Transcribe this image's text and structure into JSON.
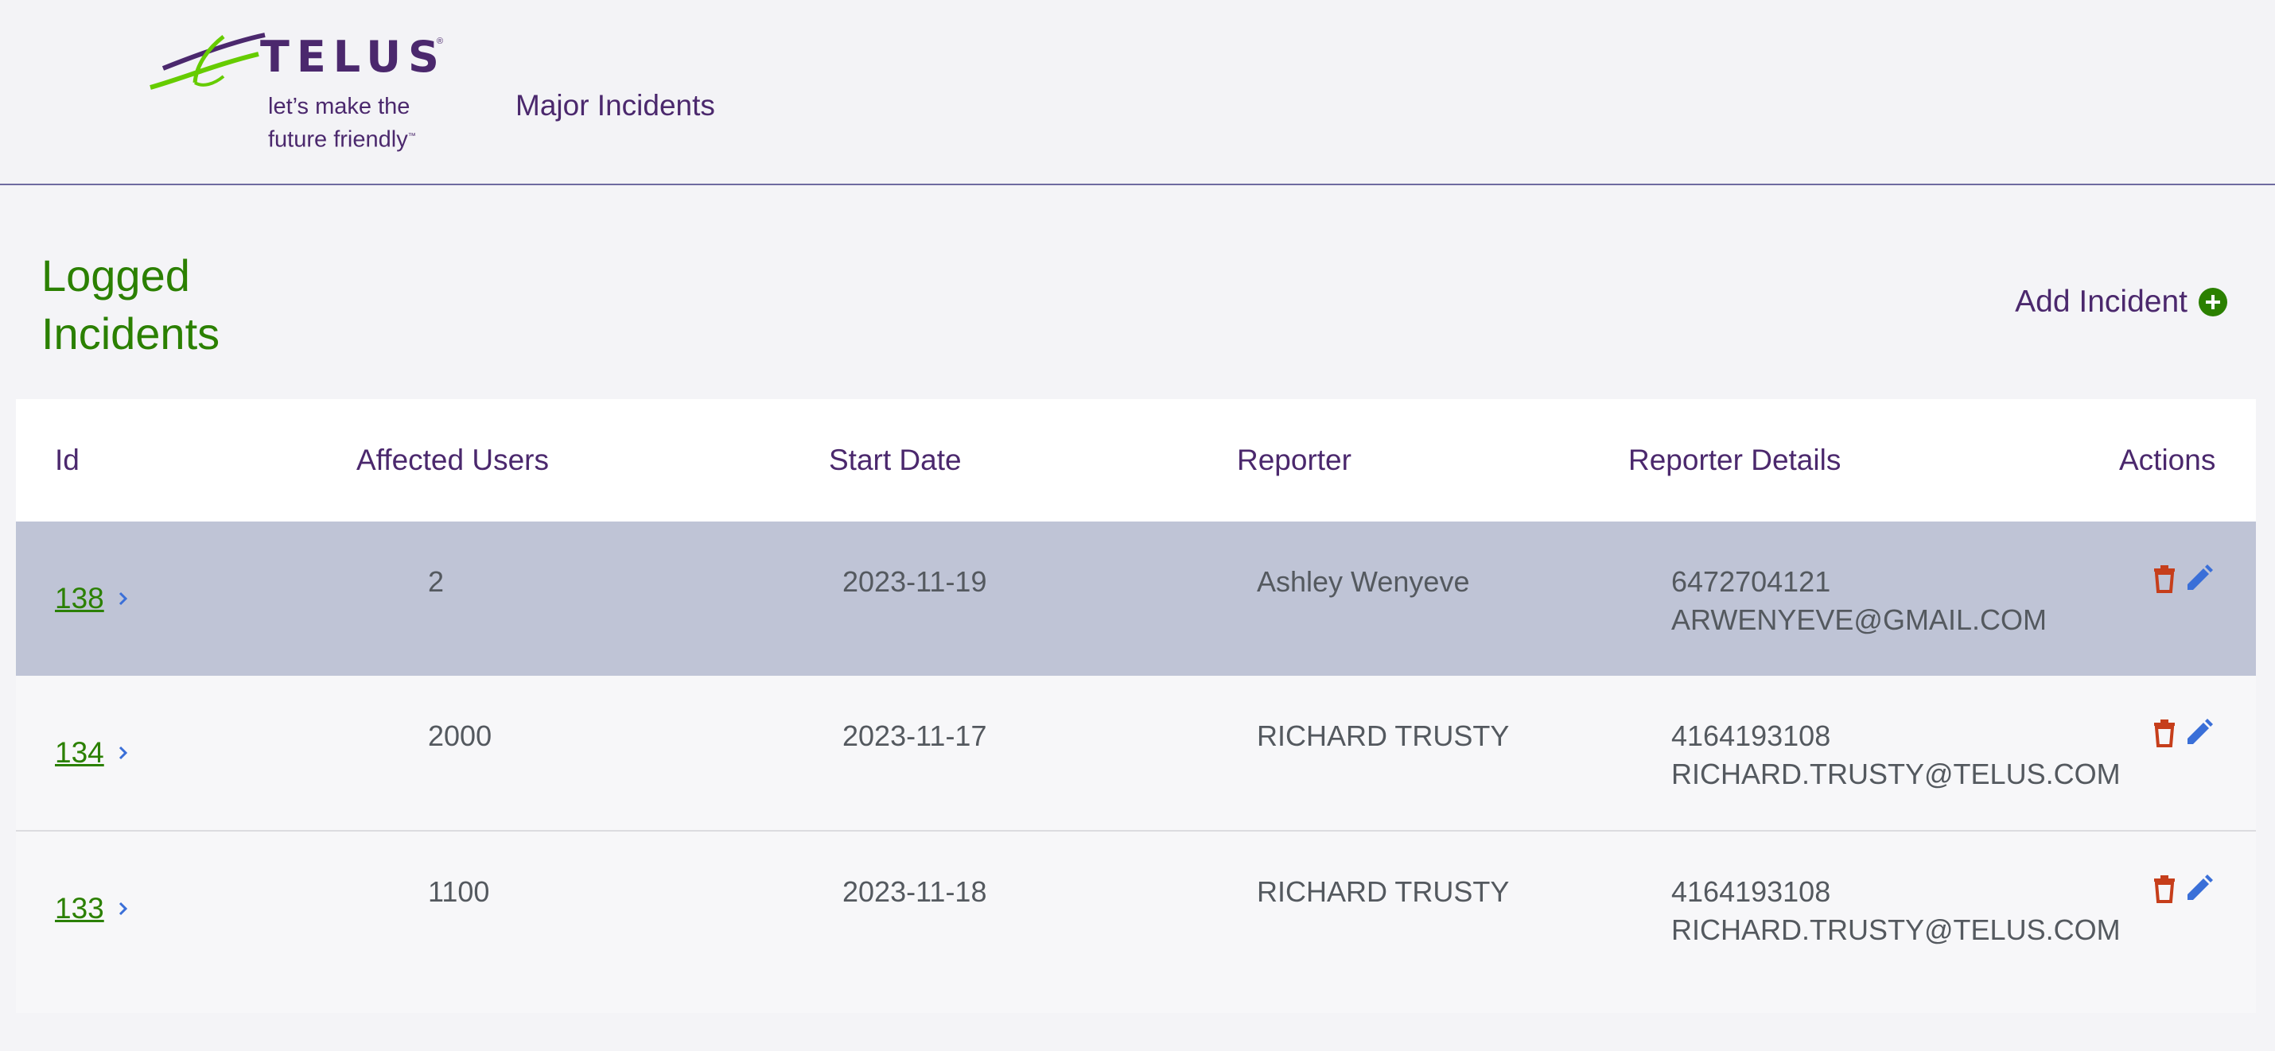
{
  "header": {
    "logo": {
      "wordmark": "TELUS",
      "tagline_line1": "let’s make the",
      "tagline_line2": "future friendly",
      "mark": "telus-swoosh-logo"
    },
    "app_title": "Major Incidents"
  },
  "page": {
    "title_line1": "Logged",
    "title_line2": "Incidents",
    "add_label": "Add Incident",
    "add_icon": "plus-circle-icon"
  },
  "table": {
    "columns": [
      "Id",
      "Affected Users",
      "Start Date",
      "Reporter",
      "Reporter Details",
      "Actions"
    ],
    "rows": [
      {
        "id": "138",
        "affected_users": "2",
        "start_date": "2023-11-19",
        "reporter": "Ashley Wenyeve",
        "phone": "6472704121",
        "email": "ARWENYEVE@GMAIL.COM",
        "selected": true
      },
      {
        "id": "134",
        "affected_users": "2000",
        "start_date": "2023-11-17",
        "reporter": "RICHARD TRUSTY",
        "phone": "4164193108",
        "email": "RICHARD.TRUSTY@TELUS.COM",
        "selected": false
      },
      {
        "id": "133",
        "affected_users": "1100",
        "start_date": "2023-11-18",
        "reporter": "RICHARD TRUSTY",
        "phone": "4164193108",
        "email": "RICHARD.TRUSTY@TELUS.COM",
        "selected": false
      }
    ],
    "icons": {
      "row_link": "chevron-right-icon",
      "delete": "trash-icon",
      "edit": "pencil-icon"
    }
  },
  "colors": {
    "brand_purple": "#4b286d",
    "brand_green": "#2b8000",
    "selected_row": "#bfc4d6",
    "delete_icon": "#c63e1b",
    "edit_icon": "#3a6fd8",
    "link_chevron": "#3a6fd8"
  }
}
